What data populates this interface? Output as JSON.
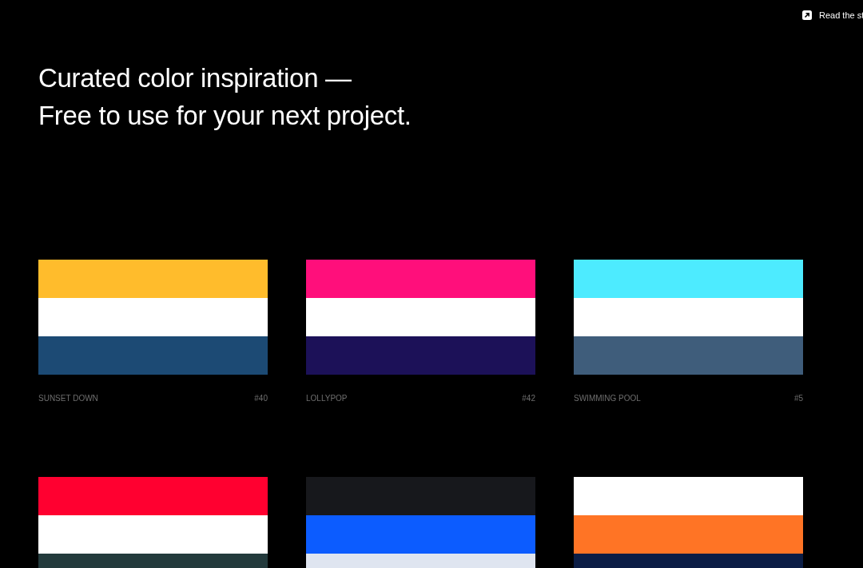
{
  "top_link": {
    "label": "Read the st"
  },
  "heading": [
    "Curated color inspiration —",
    "Free to use for your next project."
  ],
  "palettes": [
    {
      "name": "SUNSET DOWN",
      "number": "#40",
      "stripes": [
        {
          "color": "#ffbc2c"
        },
        {
          "color": "#ffffff"
        },
        {
          "color": "#1c4a74"
        }
      ]
    },
    {
      "name": "LOLLYPOP",
      "number": "#42",
      "stripes": [
        {
          "color": "#ff0f7b"
        },
        {
          "color": "#ffffff"
        },
        {
          "color": "#1c1158"
        }
      ]
    },
    {
      "name": "SWIMMING POOL",
      "number": "#5",
      "stripes": [
        {
          "color": "#4debff"
        },
        {
          "color": "#ffffff"
        },
        {
          "color": "#3f5d7b"
        }
      ]
    },
    {
      "stripes": [
        {
          "color": "#ff0030"
        },
        {
          "color": "#ffffff"
        },
        {
          "color": "#233a3c"
        }
      ]
    },
    {
      "stripes": [
        {
          "color": "#17181c"
        },
        {
          "color": "#0c5cff"
        },
        {
          "color": "#dfe5f0"
        }
      ]
    },
    {
      "stripes": [
        {
          "color": "#ffffff"
        },
        {
          "color": "#ff7425"
        },
        {
          "color": "#0b1d45"
        }
      ]
    }
  ]
}
